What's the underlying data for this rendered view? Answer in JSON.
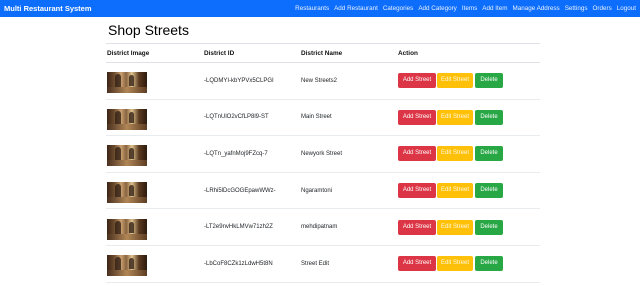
{
  "navbar": {
    "brand": "Multi Restaurant System",
    "links": [
      "Restaurants",
      "Add Restaurant",
      "Categories",
      "Add Category",
      "Items",
      "Add Item",
      "Manage Address",
      "Settings",
      "Orders",
      "Logout"
    ],
    "color": "#0d6efd"
  },
  "page": {
    "title": "Shop Streets"
  },
  "table": {
    "headers": [
      "District Image",
      "District ID",
      "District Name",
      "Action"
    ],
    "rows": [
      {
        "image_icon": "street-photo",
        "id": "-LQDMYI-kbYPVx5CLPGI",
        "name": "New Streets2"
      },
      {
        "image_icon": "street-photo",
        "id": "-LQTnUlO2vCfLP8l9-ST",
        "name": "Main Street"
      },
      {
        "image_icon": "street-photo",
        "id": "-LQTn_yafnMoj9FZcq-7",
        "name": "Newyork Street"
      },
      {
        "image_icon": "street-photo",
        "id": "-LRhi5lDcGOGEpawWWz-",
        "name": "Ngaramtoni"
      },
      {
        "image_icon": "street-photo",
        "id": "-LT2e9nvHkLMVw71zh2Z",
        "name": "mehdipatnam"
      },
      {
        "image_icon": "street-photo",
        "id": "-LbCoF8CZk1zLdwH5t8N",
        "name": "Street Edit"
      }
    ],
    "actions": {
      "add": "Add Street",
      "edit": "Edit Street",
      "delete": "Delete"
    }
  },
  "colors": {
    "add": "#dc3545",
    "edit": "#ffc107",
    "delete": "#28a745"
  }
}
